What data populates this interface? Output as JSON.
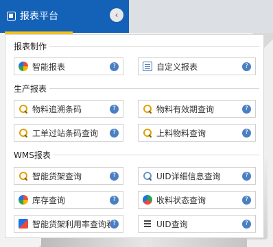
{
  "app": {
    "title": "报表平台"
  },
  "sections": [
    {
      "title": "报表制作",
      "items": [
        {
          "label": "智能报表",
          "icon": "color-wheel-icon"
        },
        {
          "label": "自定义报表",
          "icon": "document-icon"
        }
      ]
    },
    {
      "title": "生产报表",
      "items": [
        {
          "label": "物料追溯条码",
          "icon": "search-icon"
        },
        {
          "label": "物料有效期查询",
          "icon": "search-icon"
        },
        {
          "label": "工单过站条码查询",
          "icon": "search-icon"
        },
        {
          "label": "上料物料查询",
          "icon": "search-icon"
        }
      ]
    },
    {
      "title": "WMS报表",
      "items": [
        {
          "label": "智能货架查询",
          "icon": "search-icon"
        },
        {
          "label": "UID详细信息查询",
          "icon": "search-icon"
        },
        {
          "label": "库存查询",
          "icon": "color-wheel-icon"
        },
        {
          "label": "收料状态查询",
          "icon": "status-icon"
        },
        {
          "label": "智能货架利用率查询看板",
          "icon": "grid-icon"
        },
        {
          "label": "UID查询",
          "icon": "list-icon"
        }
      ]
    }
  ],
  "help_glyph": "?",
  "collapse_glyph": "‹",
  "colors": {
    "topbar": "#1461b8",
    "accent": "#f2c21b",
    "help": "#4a7fc3"
  }
}
